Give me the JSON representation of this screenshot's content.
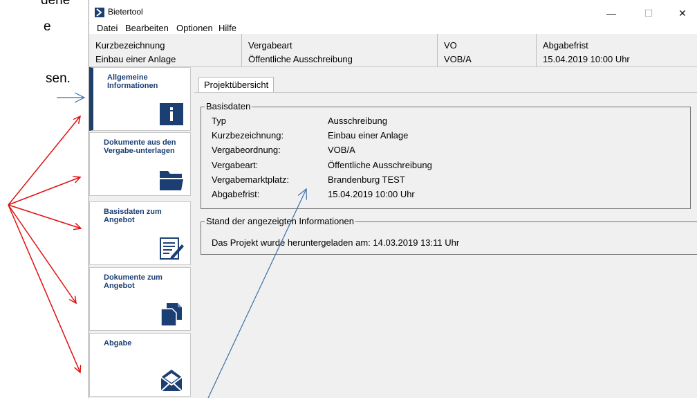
{
  "background_text": {
    "fragment_1": "dene",
    "fragment_2": "e",
    "fragment_3": "sen."
  },
  "window": {
    "title": "Bietertool",
    "controls": {
      "minimize": "—",
      "maximize": "☐",
      "close": "✕"
    }
  },
  "menu": [
    "Datei",
    "Bearbeiten",
    "Optionen",
    "Hilfe"
  ],
  "info": {
    "kurz_label": "Kurzbezeichnung",
    "kurz_value": "Einbau einer Anlage",
    "art_label": "Vergabeart",
    "art_value": "Öffentliche Ausschreibung",
    "vo_label": "VO",
    "vo_value": "VOB/A",
    "frist_label": "Abgabefrist",
    "frist_value": "15.04.2019 10:00 Uhr"
  },
  "nav": [
    {
      "label": "Allgemeine Informationen",
      "icon": "info-icon",
      "active": true
    },
    {
      "label": "Dokumente aus den Vergabe-unterlagen",
      "icon": "folder-icon",
      "active": false
    },
    {
      "label": "Basisdaten zum Angebot",
      "icon": "edit-document-icon",
      "active": false
    },
    {
      "label": "Dokumente zum Angebot",
      "icon": "documents-icon",
      "active": false
    },
    {
      "label": "Abgabe",
      "icon": "envelope-icon",
      "active": false
    }
  ],
  "tab": {
    "label": "Projektübersicht"
  },
  "basisdaten": {
    "title": "Basisdaten",
    "rows": [
      {
        "key": "Typ",
        "value": "Ausschreibung"
      },
      {
        "key": "Kurzbezeichnung:",
        "value": "Einbau einer Anlage"
      },
      {
        "key": "Vergabeordnung:",
        "value": "VOB/A"
      },
      {
        "key": "Vergabeart:",
        "value": "Öffentliche Ausschreibung"
      },
      {
        "key": "Vergabemarktplatz:",
        "value": "Brandenburg TEST"
      },
      {
        "key": "Abgabefrist:",
        "value": "15.04.2019 10:00 Uhr"
      }
    ]
  },
  "stand": {
    "title": "Stand der angezeigten Informationen",
    "text": "Das Projekt wurde heruntergeladen am: 14.03.2019 13:11 Uhr"
  },
  "colors": {
    "navy": "#1c3f73",
    "arrow_red": "#e01010",
    "arrow_blue": "#3a6ea5",
    "window_bg": "#f0f0f0"
  }
}
